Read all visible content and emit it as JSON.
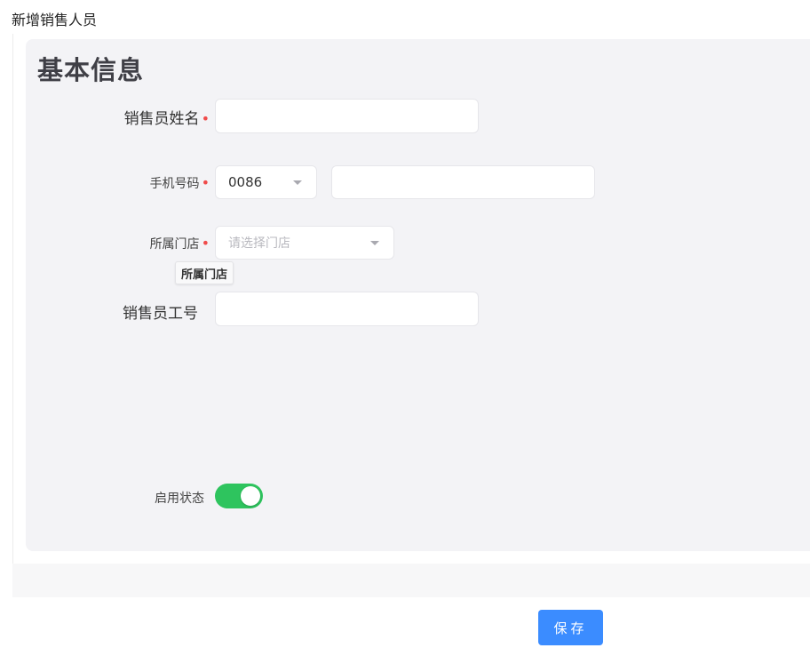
{
  "page_title": "新增销售人员",
  "section_title": "基本信息",
  "form": {
    "name": {
      "label": "销售员姓名",
      "required_mark": "•",
      "value": ""
    },
    "phone": {
      "label": "手机号码",
      "required_mark": "•",
      "country_code": "0086",
      "value": ""
    },
    "store": {
      "label": "所属门店",
      "required_mark": "•",
      "placeholder": "请选择门店",
      "tooltip": "所属门店"
    },
    "employee_id": {
      "label": "销售员工号",
      "value": ""
    },
    "status": {
      "label": "启用状态",
      "enabled": true
    }
  },
  "actions": {
    "save_label": "保存"
  },
  "colors": {
    "accent": "#3b8cff",
    "toggle_on": "#2ec45e",
    "required": "#f04b4b"
  },
  "icons": {
    "select_caret": "caret-down-icon"
  }
}
